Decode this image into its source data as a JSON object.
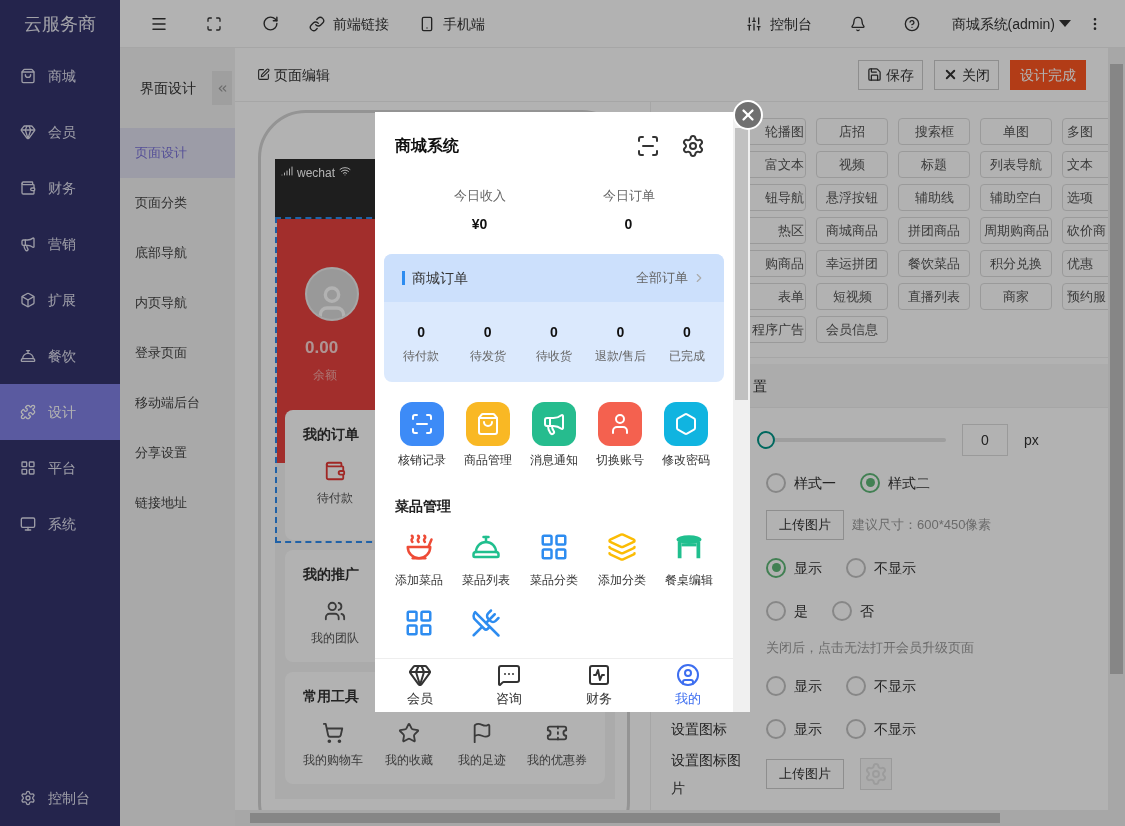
{
  "brand": "云服务商",
  "sidebar": {
    "items": [
      {
        "label": "商城",
        "kind": "bag",
        "selected": false
      },
      {
        "label": "会员",
        "kind": "gem",
        "selected": false
      },
      {
        "label": "财务",
        "kind": "wallet",
        "selected": false
      },
      {
        "label": "营销",
        "kind": "megaphone",
        "selected": false
      },
      {
        "label": "扩展",
        "kind": "box",
        "selected": false
      },
      {
        "label": "餐饮",
        "kind": "bell",
        "selected": false
      },
      {
        "label": "设计",
        "kind": "puzzle",
        "selected": true
      },
      {
        "label": "平台",
        "kind": "grid",
        "selected": false
      },
      {
        "label": "系统",
        "kind": "monitor",
        "selected": false
      }
    ],
    "footer": "控制台"
  },
  "topbar": {
    "links": [
      {
        "label": "前端链接",
        "kind": "link"
      },
      {
        "label": "手机端",
        "kind": "phone"
      }
    ],
    "console": "控制台",
    "user": "商城系统(admin)"
  },
  "subnav": {
    "title": "界面设计",
    "items": [
      {
        "label": "页面设计",
        "selected": true
      },
      {
        "label": "页面分类",
        "selected": false
      },
      {
        "label": "底部导航",
        "selected": false
      },
      {
        "label": "内页导航",
        "selected": false
      },
      {
        "label": "登录页面",
        "selected": false
      },
      {
        "label": "移动端后台",
        "selected": false
      },
      {
        "label": "分享设置",
        "selected": false
      },
      {
        "label": "链接地址",
        "selected": false
      }
    ]
  },
  "editor": {
    "title": "页面编辑",
    "buttons": [
      {
        "label": "保存",
        "kind": "save"
      },
      {
        "label": "关闭",
        "kind": "close"
      },
      {
        "label": "设计完成",
        "kind": "primary"
      }
    ]
  },
  "preview": {
    "status": "wechat",
    "balance": "0.00",
    "balance_label": "余额",
    "sections": [
      {
        "title": "我的订单",
        "items": [
          {
            "label": "待付款",
            "kind": "wallet"
          }
        ]
      },
      {
        "title": "我的推广",
        "items": [
          {
            "label": "我的团队",
            "kind": "users"
          }
        ]
      },
      {
        "title": "常用工具",
        "items": [
          {
            "label": "我的购物车",
            "kind": "cart"
          },
          {
            "label": "我的收藏",
            "kind": "star"
          },
          {
            "label": "我的足迹",
            "kind": "flag"
          },
          {
            "label": "我的优惠券",
            "kind": "ticket"
          }
        ]
      }
    ]
  },
  "components": [
    [
      "轮播图",
      "店招",
      "搜索框",
      "单图",
      "多图"
    ],
    [
      "富文本",
      "视频",
      "标题",
      "列表导航",
      "文本"
    ],
    [
      "钮导航",
      "悬浮按钮",
      "辅助线",
      "辅助空白",
      "选项"
    ],
    [
      "热区",
      "商城商品",
      "拼团商品",
      "周期购商品",
      "砍价商"
    ],
    [
      "购商品",
      "幸运拼团",
      "餐饮菜品",
      "积分兑换",
      "优惠"
    ],
    [
      "表单",
      "短视频",
      "直播列表",
      "商家",
      "预约服"
    ],
    [
      "程序广告",
      "会员信息"
    ]
  ],
  "settings": {
    "heading": "置",
    "rows": [
      {
        "kind": "slider",
        "level": 0,
        "value": "0",
        "unit": "px"
      },
      {
        "kind": "radio",
        "options": [
          {
            "label": "样式一",
            "selected": false
          },
          {
            "label": "样式二",
            "selected": true
          }
        ]
      },
      {
        "kind": "upload",
        "button": "上传图片",
        "hint": "建议尺寸：600*450像素"
      },
      {
        "kind": "radio",
        "options": [
          {
            "label": "显示",
            "selected": true
          },
          {
            "label": "不显示",
            "selected": false
          }
        ]
      },
      {
        "kind": "radio",
        "options": [
          {
            "label": "是",
            "selected": false
          },
          {
            "label": "否",
            "selected": false
          }
        ]
      },
      {
        "kind": "hint",
        "hint": "关闭后，点击无法打开会员升级页面"
      },
      {
        "kind": "radio",
        "options": [
          {
            "label": "显示",
            "selected": false
          },
          {
            "label": "不显示",
            "selected": false
          }
        ]
      },
      {
        "kind": "radio",
        "label": "设置图标",
        "options": [
          {
            "label": "显示",
            "selected": false
          },
          {
            "label": "不显示",
            "selected": false
          }
        ]
      },
      {
        "kind": "image",
        "label": "设置图标图片",
        "button": "上传图片"
      }
    ]
  },
  "modal": {
    "title": "商城系统",
    "stats": [
      {
        "label": "今日收入",
        "value": "¥0"
      },
      {
        "label": "今日订单",
        "value": "0"
      }
    ],
    "orders": {
      "title": "商城订单",
      "link": "全部订单",
      "counts": [
        {
          "value": "0",
          "label": "待付款"
        },
        {
          "value": "0",
          "label": "待发货"
        },
        {
          "value": "0",
          "label": "待收货"
        },
        {
          "value": "0",
          "label": "退款/售后"
        },
        {
          "value": "0",
          "label": "已完成"
        }
      ]
    },
    "shortcuts": [
      {
        "label": "核销记录",
        "kind": "scan",
        "color": "#3d8bf7"
      },
      {
        "label": "商品管理",
        "kind": "bag",
        "color": "#f9b824"
      },
      {
        "label": "消息通知",
        "kind": "megaphone",
        "color": "#26bc8e"
      },
      {
        "label": "切换账号",
        "kind": "user",
        "color": "#f4614f"
      },
      {
        "label": "修改密码",
        "kind": "hexagon",
        "color": "#10b4e0"
      }
    ],
    "dishes_title": "菜品管理",
    "dishes": [
      {
        "label": "添加菜品",
        "kind": "soup"
      },
      {
        "label": "菜品列表",
        "kind": "cloche"
      },
      {
        "label": "菜品分类",
        "kind": "grid"
      },
      {
        "label": "添加分类",
        "kind": "layers"
      },
      {
        "label": "餐桌编辑",
        "kind": "table"
      },
      {
        "kind": "grid"
      },
      {
        "kind": "utensils"
      }
    ],
    "tabs": [
      {
        "label": "会员",
        "kind": "gem",
        "selected": false
      },
      {
        "label": "咨询",
        "kind": "chat",
        "selected": false
      },
      {
        "label": "财务",
        "kind": "chart",
        "selected": false
      },
      {
        "label": "我的",
        "kind": "user",
        "selected": true
      }
    ]
  }
}
